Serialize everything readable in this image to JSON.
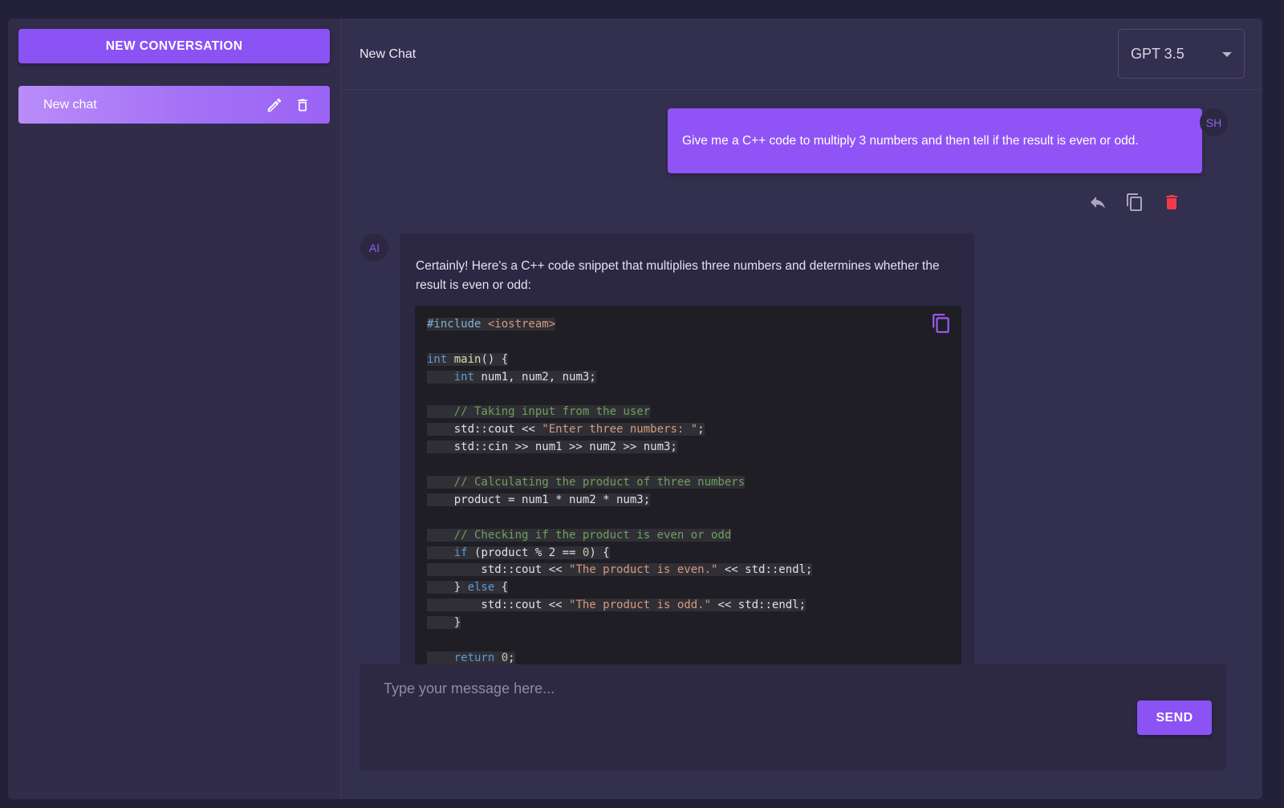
{
  "sidebar": {
    "new_conversation_label": "NEW CONVERSATION",
    "chats": [
      {
        "label": "New chat"
      }
    ],
    "icons": {
      "edit": "pencil-icon",
      "delete": "trash-icon"
    }
  },
  "header": {
    "title": "New Chat",
    "model_select": {
      "value": "GPT 3.5"
    }
  },
  "messages": {
    "user": {
      "avatar": "SH",
      "text": "Give me a C++ code to multiply 3 numbers and then tell if the result is even or odd.",
      "actions": [
        "reply-icon",
        "copy-icon",
        "delete-icon"
      ]
    },
    "ai": {
      "avatar": "AI",
      "intro": "Certainly! Here's a C++ code snippet that multiplies three numbers and determines whether the result is even or odd:",
      "code_lines": [
        [
          {
            "t": "#include ",
            "c": "pre"
          },
          {
            "t": "<iostream>",
            "c": "str"
          }
        ],
        [],
        [
          {
            "t": "int ",
            "c": "kw"
          },
          {
            "t": "main",
            "c": "fn"
          },
          {
            "t": "() {",
            "c": ""
          }
        ],
        [
          {
            "t": "    ",
            "c": ""
          },
          {
            "t": "int ",
            "c": "kw"
          },
          {
            "t": "num1, num2, num3;",
            "c": ""
          }
        ],
        [],
        [
          {
            "t": "    // Taking input from the user",
            "c": "cmt"
          }
        ],
        [
          {
            "t": "    std::cout << ",
            "c": ""
          },
          {
            "t": "\"Enter three numbers: \"",
            "c": "str"
          },
          {
            "t": ";",
            "c": ""
          }
        ],
        [
          {
            "t": "    std::cin >> num1 >> num2 >> num3;",
            "c": ""
          }
        ],
        [],
        [
          {
            "t": "    // Calculating the product of three numbers",
            "c": "cmt"
          }
        ],
        [
          {
            "t": "    product = num1 * num2 * num3;",
            "c": ""
          }
        ],
        [],
        [
          {
            "t": "    // Checking if the product is even or odd",
            "c": "cmt"
          }
        ],
        [
          {
            "t": "    ",
            "c": ""
          },
          {
            "t": "if ",
            "c": "kw"
          },
          {
            "t": "(product % 2 == ",
            "c": ""
          },
          {
            "t": "0",
            "c": "num"
          },
          {
            "t": ") {",
            "c": ""
          }
        ],
        [
          {
            "t": "        std::cout << ",
            "c": ""
          },
          {
            "t": "\"The product is even.\"",
            "c": "str"
          },
          {
            "t": " << std::endl;",
            "c": ""
          }
        ],
        [
          {
            "t": "    } ",
            "c": ""
          },
          {
            "t": "else ",
            "c": "kw"
          },
          {
            "t": "{",
            "c": ""
          }
        ],
        [
          {
            "t": "        std::cout << ",
            "c": ""
          },
          {
            "t": "\"The product is odd.\"",
            "c": "str"
          },
          {
            "t": " << std::endl;",
            "c": ""
          }
        ],
        [
          {
            "t": "    }",
            "c": ""
          }
        ],
        [],
        [
          {
            "t": "    ",
            "c": ""
          },
          {
            "t": "return ",
            "c": "kw"
          },
          {
            "t": "0",
            "c": "num"
          },
          {
            "t": ";",
            "c": ""
          }
        ],
        [
          {
            "t": "}",
            "c": ""
          }
        ]
      ]
    }
  },
  "composer": {
    "placeholder": "Type your message here...",
    "value": "",
    "send_label": "SEND"
  },
  "colors": {
    "accent": "#8b52f4",
    "danger": "#ef3b4c",
    "background": "#332f4e"
  }
}
